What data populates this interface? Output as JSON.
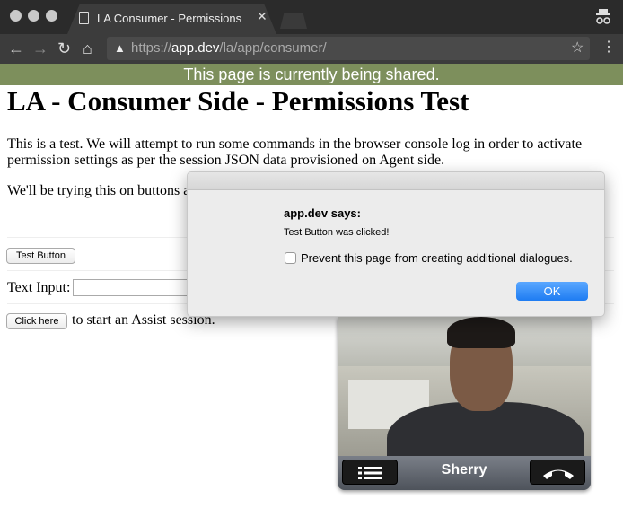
{
  "browser": {
    "tab_title": "LA Consumer - Permissions",
    "tab_close": "✕",
    "url_scheme": "https://",
    "url_host": "app.dev",
    "url_path": "/la/app/consumer/",
    "back_glyph": "←",
    "forward_glyph": "→",
    "reload_glyph": "C",
    "home_glyph": "⌂",
    "warning_glyph": "▲",
    "star_glyph": "☆",
    "menu_glyph": "⋮"
  },
  "share_banner": "This page is currently being shared.",
  "page": {
    "heading": "LA - Consumer Side - Permissions Test",
    "paragraph1": "This is a test. We will attempt to run some commands in the browser console log in order to activate permission settings as per the session JSON data provisioned on Agent side.",
    "paragraph2": "We'll be trying this on buttons a",
    "test_button": "Test Button",
    "text_input_label": "Text Input:",
    "text_input_value": "",
    "click_here_button": "Click here",
    "assist_text": "to start an Assist session."
  },
  "dialog": {
    "title": "app.dev says:",
    "message": "Test Button was clicked!",
    "checkbox_label": "Prevent this page from creating additional dialogues.",
    "checkbox_checked": false,
    "ok_label": "OK"
  },
  "video": {
    "caller_name": "Sherry"
  },
  "colors": {
    "share_banner": "#7d8f5c",
    "ok_button": "#1e7cf2",
    "chrome_dark": "#2b2b2b"
  }
}
